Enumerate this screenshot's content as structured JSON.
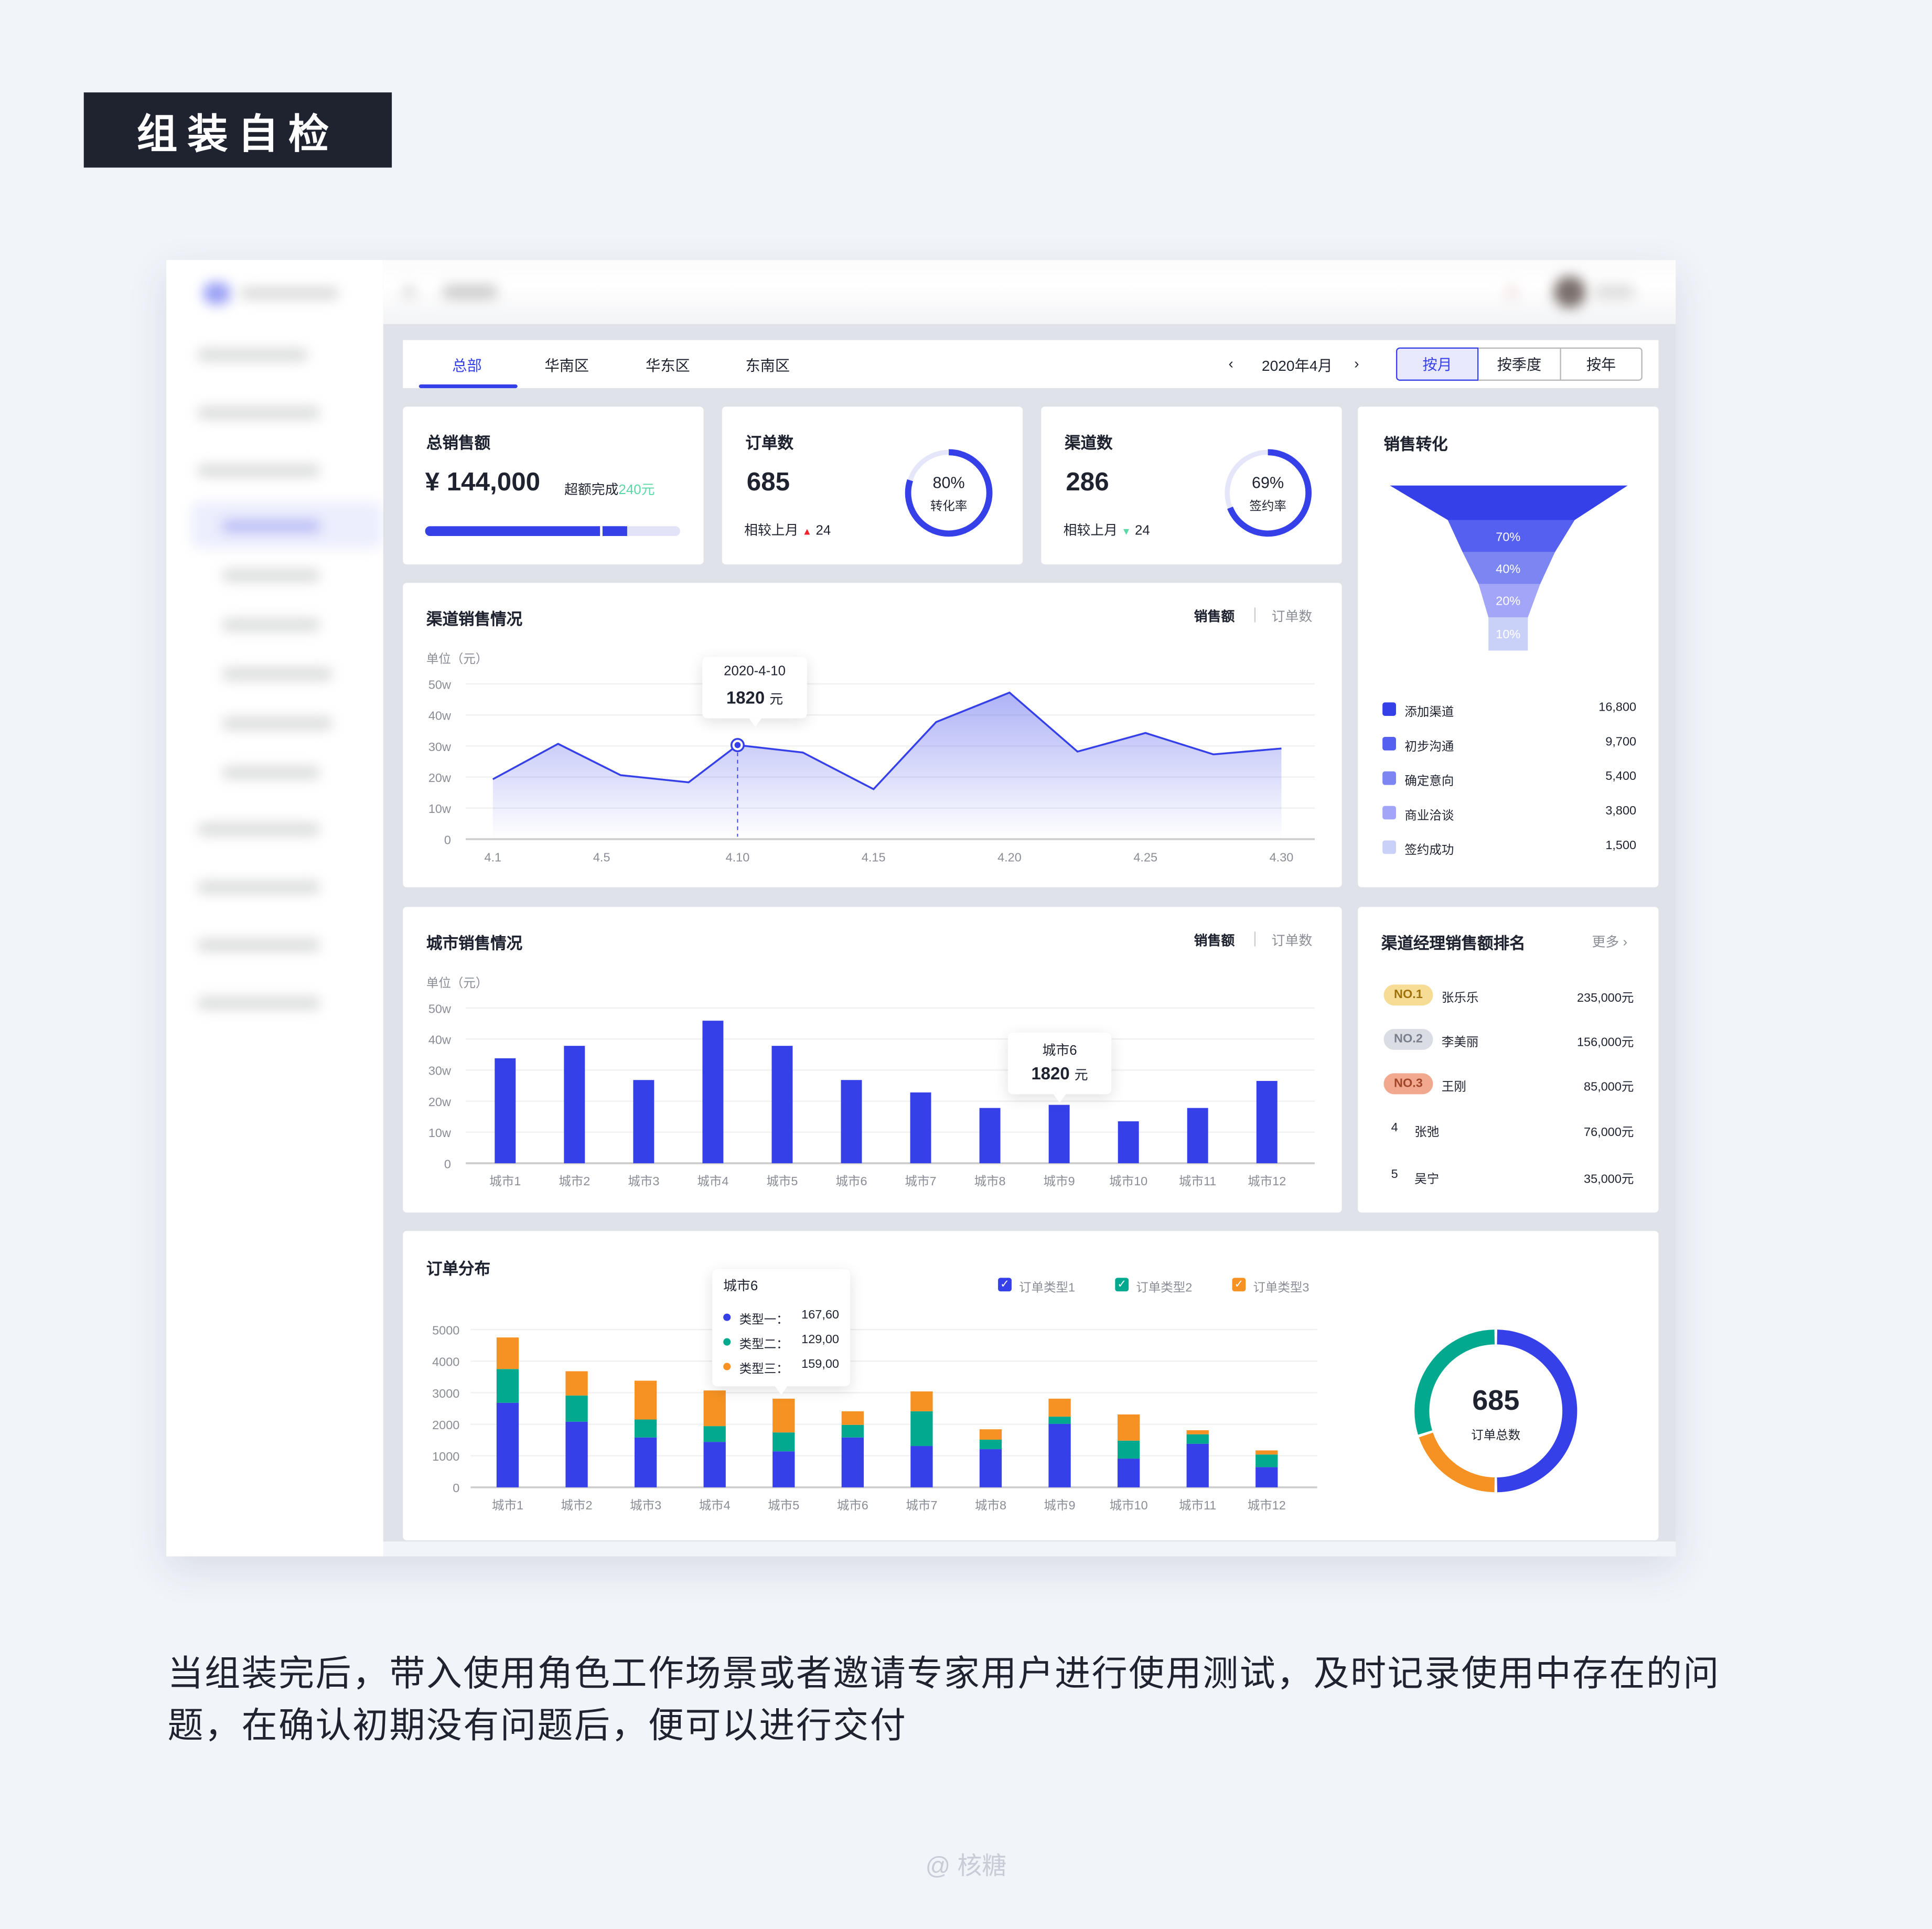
{
  "page_title": "组装自检",
  "description": "当组装完后，带入使用角色工作场景或者邀请专家用户进行使用测试，及时记录使用中存在的问题，在确认初期没有问题后，便可以进行交付",
  "watermark": "@ 核糖",
  "colors": {
    "primary": "#3640e8",
    "green": "#02a98f",
    "orange": "#f59223",
    "up": "#f5222d",
    "down": "#5ad8a6"
  },
  "tabs": [
    {
      "label": "总部",
      "active": true
    },
    {
      "label": "华南区"
    },
    {
      "label": "华东区"
    },
    {
      "label": "东南区"
    }
  ],
  "date_nav": {
    "prev_icon": "chevron-left-icon",
    "label": "2020年4月",
    "next_icon": "chevron-right-icon"
  },
  "period_buttons": [
    {
      "label": "按月",
      "active": true
    },
    {
      "label": "按季度"
    },
    {
      "label": "按年"
    }
  ],
  "kpis": {
    "sales": {
      "title": "总销售额",
      "value": "¥ 144,000",
      "note": "超额完成",
      "note_value": "240元",
      "progress": 0.79
    },
    "orders": {
      "title": "订单数",
      "value": "685",
      "compare": "相较上月",
      "delta": "24",
      "trend": "up",
      "ring_value": "80%",
      "ring_label": "转化率",
      "ring_fraction": 0.8
    },
    "channels": {
      "title": "渠道数",
      "value": "286",
      "compare": "相较上月",
      "delta": "24",
      "trend": "down",
      "ring_value": "69%",
      "ring_label": "签约率",
      "ring_fraction": 0.69
    }
  },
  "channel_sales": {
    "title": "渠道销售情况",
    "toggle": [
      "销售额",
      "订单数"
    ],
    "unit": "单位（元）",
    "tooltip": {
      "date": "2020-4-10",
      "value": "1820",
      "unit": "元"
    }
  },
  "city_sales": {
    "title": "城市销售情况",
    "toggle": [
      "销售额",
      "订单数"
    ],
    "unit": "单位（元）",
    "tooltip": {
      "city": "城市6",
      "value": "1820",
      "unit": "元"
    }
  },
  "funnel": {
    "title": "销售转化",
    "levels": [
      {
        "label": "添加渠道",
        "value": "16,800",
        "pct": "",
        "color": "#3640e8"
      },
      {
        "label": "初步沟通",
        "value": "9,700",
        "pct": "70%",
        "color": "#5560f0"
      },
      {
        "label": "确定意向",
        "value": "5,400",
        "pct": "40%",
        "color": "#7b86f2"
      },
      {
        "label": "商业洽谈",
        "value": "3,800",
        "pct": "20%",
        "color": "#a3a6f8"
      },
      {
        "label": "签约成功",
        "value": "1,500",
        "pct": "10%",
        "color": "#cad1f8"
      }
    ]
  },
  "ranking": {
    "title": "渠道经理销售额排名",
    "more": "更多",
    "rows": [
      {
        "rank": "NO.1",
        "name": "张乐乐",
        "amount": "235,000元"
      },
      {
        "rank": "NO.2",
        "name": "李美丽",
        "amount": "156,000元"
      },
      {
        "rank": "NO.3",
        "name": "王刚",
        "amount": "85,000元"
      },
      {
        "rank": "4",
        "name": "张弛",
        "amount": "76,000元"
      },
      {
        "rank": "5",
        "name": "吴宁",
        "amount": "35,000元"
      }
    ]
  },
  "order_dist": {
    "title": "订单分布",
    "legend": [
      "订单类型1",
      "订单类型2",
      "订单类型3"
    ],
    "tooltip": {
      "city": "城市6",
      "rows": [
        {
          "label": "类型一：",
          "value": "167,60"
        },
        {
          "label": "类型二：",
          "value": "129,00"
        },
        {
          "label": "类型三：",
          "value": "159,00"
        }
      ]
    },
    "donut": {
      "value": "685",
      "label": "订单总数"
    }
  },
  "chart_data": [
    {
      "type": "area",
      "title": "渠道销售情况",
      "ylabel": "单位（元）",
      "ylim": [
        0,
        50
      ],
      "yticks": [
        "0",
        "10w",
        "20w",
        "30w",
        "40w",
        "50w"
      ],
      "xticks": [
        "4.1",
        "4.5",
        "4.10",
        "4.15",
        "4.20",
        "4.25",
        "4.30"
      ],
      "xtick_values": [
        1,
        5,
        10,
        15,
        20,
        25,
        30
      ],
      "x": [
        1,
        3.4,
        5.7,
        8.2,
        10,
        12.4,
        15,
        17.3,
        20,
        22.5,
        25,
        27.5,
        30
      ],
      "y": [
        19.3,
        30.7,
        20.6,
        18.3,
        30.3,
        27.9,
        16.1,
        37.7,
        47.2,
        28.2,
        34.2,
        27.3,
        29.2
      ],
      "highlight_index": 4,
      "grid": true
    },
    {
      "type": "bar",
      "title": "城市销售情况",
      "ylabel": "单位（元）",
      "ylim": [
        0,
        50
      ],
      "yticks": [
        "0",
        "10w",
        "20w",
        "30w",
        "40w",
        "50w"
      ],
      "categories": [
        "城市1",
        "城市2",
        "城市3",
        "城市4",
        "城市5",
        "城市6",
        "城市7",
        "城市8",
        "城市9",
        "城市10",
        "城市11",
        "城市12"
      ],
      "values": [
        33.8,
        37.8,
        26.8,
        45.9,
        37.8,
        26.8,
        22.8,
        17.8,
        18.8,
        13.5,
        17.8,
        26.5
      ],
      "grid": true
    },
    {
      "type": "bar",
      "stacked": true,
      "title": "订单分布",
      "ylim": [
        0,
        5000
      ],
      "yticks": [
        "0",
        "1000",
        "2000",
        "3000",
        "4000",
        "5000"
      ],
      "categories": [
        "城市1",
        "城市2",
        "城市3",
        "城市4",
        "城市5",
        "城市6",
        "城市7",
        "城市8",
        "城市9",
        "城市10",
        "城市11",
        "城市12"
      ],
      "series": [
        {
          "name": "订单类型1",
          "color": "#3640e8",
          "values": [
            2680,
            2080,
            1580,
            1440,
            1140,
            1580,
            1310,
            1210,
            2010,
            910,
            1380,
            640
          ]
        },
        {
          "name": "订单类型2",
          "color": "#02a98f",
          "values": [
            1070,
            830,
            570,
            500,
            600,
            400,
            1100,
            300,
            230,
            570,
            300,
            400
          ]
        },
        {
          "name": "订单类型3",
          "color": "#f59223",
          "values": [
            1000,
            770,
            1230,
            1130,
            1070,
            430,
            630,
            330,
            570,
            830,
            130,
            130
          ]
        }
      ],
      "legend": "top-right",
      "grid": true
    },
    {
      "type": "pie",
      "donut": true,
      "title": "订单总数",
      "categories": [
        "订单类型1",
        "订单类型3",
        "订单类型2"
      ],
      "values": [
        50,
        20,
        30
      ],
      "colors": [
        "#3640e8",
        "#f59223",
        "#02a98f"
      ]
    }
  ]
}
